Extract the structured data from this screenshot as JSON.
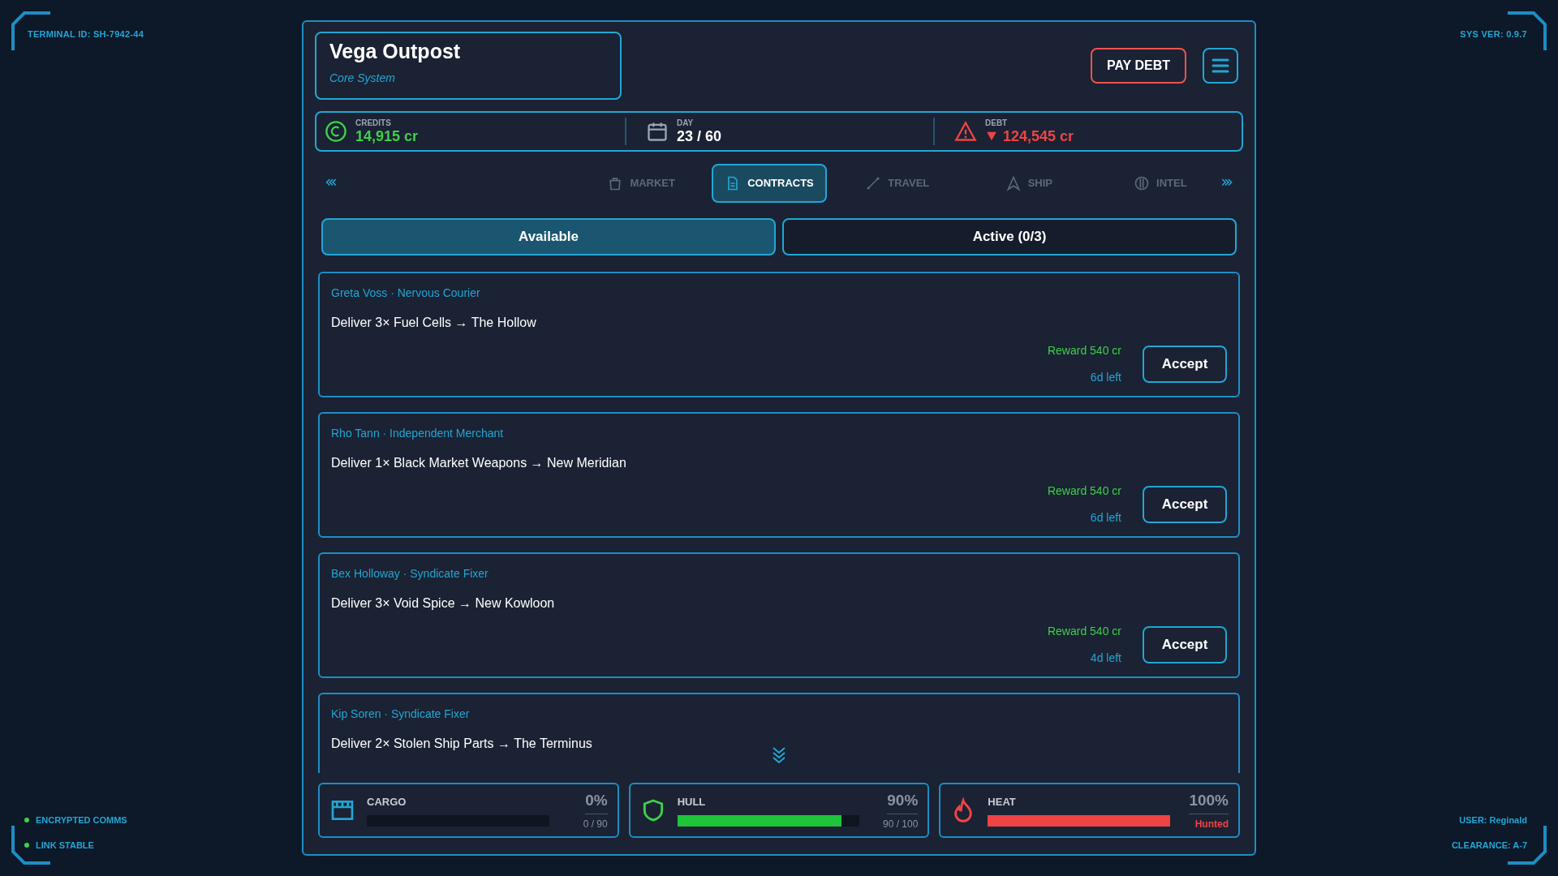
{
  "corners": {
    "terminal_id": "TERMINAL ID: SH-7942-44",
    "sys_ver": "SYS VER: 0.9.7"
  },
  "location": {
    "name": "Vega Outpost",
    "system": "Core System"
  },
  "pay_debt": "PAY DEBT",
  "stats": [
    {
      "kind": "credits",
      "label": "CREDITS",
      "value": "14,915 cr"
    },
    {
      "kind": "day",
      "label": "DAY",
      "value": "23 / 60"
    },
    {
      "kind": "debt",
      "label": "DEBT",
      "value": "124,545 cr"
    }
  ],
  "nav": [
    {
      "kind": "market",
      "label": "MARKET",
      "selected": false
    },
    {
      "kind": "contracts",
      "label": "CONTRACTS",
      "selected": true
    },
    {
      "kind": "travel",
      "label": "TRAVEL",
      "selected": false
    },
    {
      "kind": "ship",
      "label": "SHIP",
      "selected": false
    },
    {
      "kind": "intel",
      "label": "INTEL",
      "selected": false
    }
  ],
  "subtabs": [
    {
      "label": "Available",
      "selected": true
    },
    {
      "label": "Active (0/3)",
      "selected": false
    }
  ],
  "contracts": [
    {
      "client": "Greta Voss · Nervous Courier",
      "task": "Deliver 3× Fuel Cells → The Hollow",
      "reward": "Reward 540 cr",
      "time_left": "6d left",
      "button": "Accept"
    },
    {
      "client": "Rho Tann · Independent Merchant",
      "task": "Deliver 1× Black Market Weapons → New Meridian",
      "reward": "Reward 540 cr",
      "time_left": "6d left",
      "button": "Accept"
    },
    {
      "client": "Bex Holloway · Syndicate Fixer",
      "task": "Deliver 3× Void Spice → New Kowloon",
      "reward": "Reward 540 cr",
      "time_left": "4d left",
      "button": "Accept"
    },
    {
      "client": "Kip Soren · Syndicate Fixer",
      "task": "Deliver 2× Stolen Ship Parts → The Terminus"
    }
  ],
  "gauges": [
    {
      "kind": "cargo",
      "label": "CARGO",
      "percent": "0%",
      "detail": "0 / 90",
      "level": 0
    },
    {
      "kind": "hull",
      "label": "HULL",
      "percent": "90%",
      "detail": "90 / 100",
      "level": 0.9
    },
    {
      "kind": "heat",
      "label": "HEAT",
      "percent": "100%",
      "detail": "Hunted",
      "level": 1
    }
  ],
  "status": [
    "ENCRYPTED COMMS",
    "LINK STABLE"
  ],
  "user": {
    "name": "USER: Reginald",
    "clearance": "CLEARANCE: A-7"
  }
}
